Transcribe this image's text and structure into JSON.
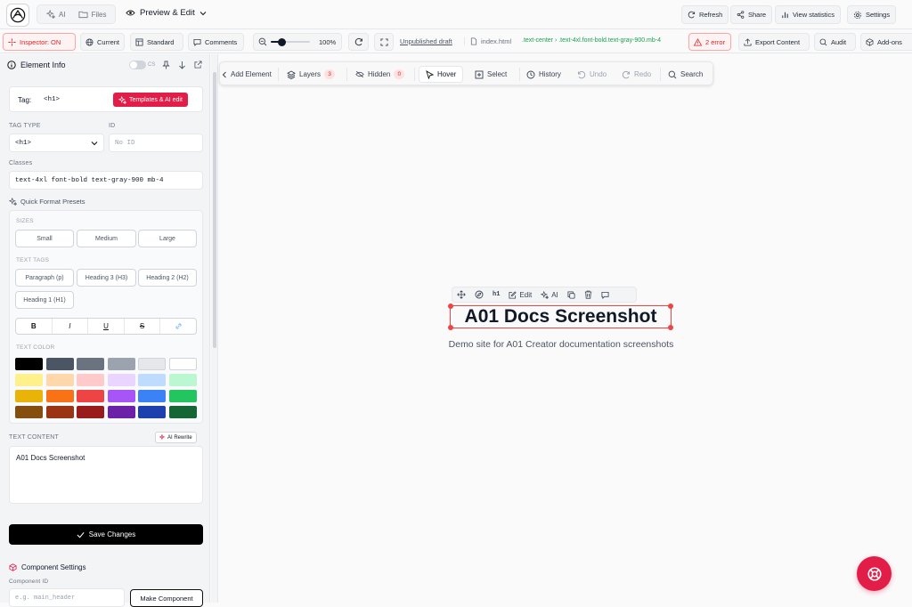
{
  "topbar": {
    "tabs": [
      {
        "label": "AI",
        "icon": "sparkles-icon"
      },
      {
        "label": "Files",
        "icon": "folder-icon"
      }
    ],
    "preview_mode": "Preview & Edit",
    "actions": [
      {
        "label": "Refresh",
        "icon": "refresh-icon"
      },
      {
        "label": "Share",
        "icon": "share-icon"
      },
      {
        "label": "View statistics",
        "icon": "bar-chart-icon"
      },
      {
        "label": "Settings",
        "icon": "gear-icon"
      }
    ]
  },
  "toolbar2": {
    "inspector": "Inspector: ON",
    "view_current": "Current",
    "view_standard": "Standard",
    "comments": "Comments",
    "zoom": "100%",
    "zoom_fraction": 0.28,
    "unpublished": "Unpublished draft",
    "file": "index.html",
    "selector": ".text-center › .text-4xl.font-bold.text-gray-900.mb-4",
    "errors": "2 error",
    "export": "Export Content",
    "audit": "Audit",
    "addons": "Add-ons"
  },
  "sidebar": {
    "title": "Element Info",
    "css_toggle_label": "CS",
    "tag_label": "Tag:",
    "tag_value": "<h1>",
    "templates_btn": "Templates & AI edit",
    "tag_type_label": "TAG TYPE",
    "tag_type_value": "<h1>",
    "id_label": "ID",
    "id_placeholder": "No ID",
    "classes_label": "Classes",
    "classes_value": "text-4xl font-bold text-gray-900 mb-4",
    "presets_title": "Quick Format Presets",
    "sizes_label": "SIZES",
    "sizes": [
      "Small",
      "Medium",
      "Large"
    ],
    "text_tags_label": "TEXT TAGS",
    "text_tags": [
      "Paragraph (p)",
      "Heading 3 (H3)",
      "Heading 2 (H2)",
      "Heading 1 (H1)"
    ],
    "format_buttons": [
      "B",
      "I",
      "U",
      "S"
    ],
    "text_color_label": "TEXT COLOR",
    "colors": [
      "#000000",
      "#4b5563",
      "#6b7280",
      "#9ca3af",
      "#e5e7eb",
      "#ffffff",
      "#fef08a",
      "#fed7aa",
      "#fecaca",
      "#e9d5ff",
      "#bfdbfe",
      "#bbf7d0",
      "#eab308",
      "#f97316",
      "#ef4444",
      "#a855f7",
      "#3b82f6",
      "#22c55e",
      "#854d0e",
      "#9a3412",
      "#991b1b",
      "#6b21a8",
      "#1e40af",
      "#166534"
    ],
    "text_content_label": "TEXT CONTENT",
    "ai_rewrite": "AI Rewrite",
    "text_content_value": "A01 Docs Screenshot",
    "save_btn": "Save Changes",
    "component_title": "Component Settings",
    "component_id_label": "Component ID",
    "component_id_placeholder": "e.g. main_header",
    "make_component": "Make Component"
  },
  "floatbar": {
    "add_element": "Add Element",
    "layers": "Layers",
    "layers_count": "3",
    "hidden": "Hidden",
    "hidden_count": "0",
    "hover": "Hover",
    "select": "Select",
    "history": "History",
    "undo": "Undo",
    "redo": "Redo",
    "search": "Search"
  },
  "canvas": {
    "inline_toolbar": {
      "tag": "h1",
      "edit": "Edit",
      "ai": "AI"
    },
    "heading": "A01 Docs Screenshot",
    "subheading": "Demo site for A01 Creator documentation screenshots"
  },
  "colors": {
    "accent_red": "#e11d48",
    "inspector_red": "#dc2626",
    "selection_red": "#ef4444",
    "selector_green": "#16a34a"
  }
}
